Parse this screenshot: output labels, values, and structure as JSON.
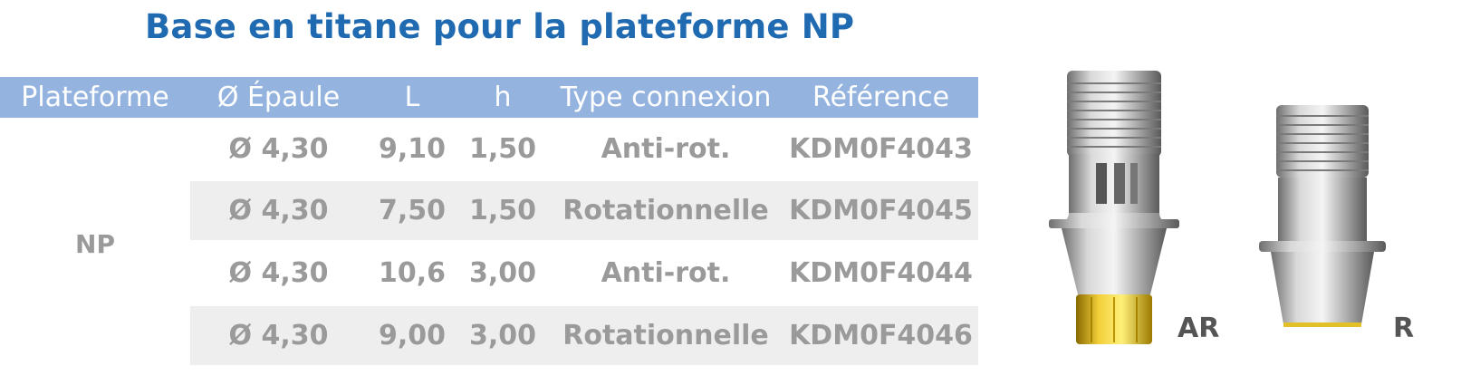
{
  "title": "Base en titane pour la plateforme NP",
  "table": {
    "headers": [
      "Plateforme",
      "Ø Épaule",
      "L",
      "h",
      "Type connexion",
      "Référence"
    ],
    "platform": "NP",
    "rows": [
      {
        "epaule": "Ø 4,30",
        "L": "9,10",
        "h": "1,50",
        "type": "Anti-rot.",
        "ref": "KDM0F4043"
      },
      {
        "epaule": "Ø 4,30",
        "L": "7,50",
        "h": "1,50",
        "type": "Rotationnelle",
        "ref": "KDM0F4045"
      },
      {
        "epaule": "Ø 4,30",
        "L": "10,6",
        "h": "3,00",
        "type": "Anti-rot.",
        "ref": "KDM0F4044"
      },
      {
        "epaule": "Ø 4,30",
        "L": "9,00",
        "h": "3,00",
        "type": "Rotationnelle",
        "ref": "KDM0F4046"
      }
    ]
  },
  "products": [
    {
      "label": "AR",
      "icon": "titanium-base-anti-rotation-image",
      "collar_color": "#d9b21a"
    },
    {
      "label": "R",
      "icon": "titanium-base-rotational-image",
      "collar_color": "#d9b21a"
    }
  ],
  "colors": {
    "title": "#1f6ab0",
    "header": "#94b3df",
    "row_alt": "#eeeeee",
    "text": "#9a9a9a"
  }
}
